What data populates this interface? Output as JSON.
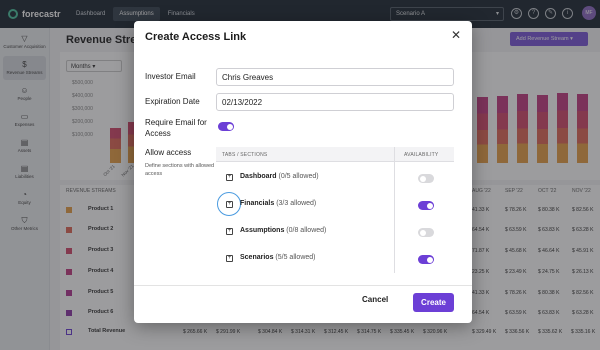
{
  "app": {
    "logo_text": "forecastr",
    "nav_tabs": [
      "Dashboard",
      "Assumptions",
      "Financials"
    ],
    "active_tab": "Assumptions",
    "scenario": "Scenario A",
    "avatar_initials": "MF"
  },
  "sidebar": {
    "items": [
      {
        "label": "Customer Acquisition",
        "icon": "funnel-icon",
        "glyph": "▽"
      },
      {
        "label": "Revenue Streams",
        "icon": "dollar-icon",
        "glyph": "$"
      },
      {
        "label": "People",
        "icon": "people-icon",
        "glyph": "☺"
      },
      {
        "label": "Expenses",
        "icon": "card-icon",
        "glyph": "▭"
      },
      {
        "label": "Assets",
        "icon": "document-icon",
        "glyph": "▤"
      },
      {
        "label": "Liabilities",
        "icon": "document-icon",
        "glyph": "▤"
      },
      {
        "label": "Equity",
        "icon": "pie-icon",
        "glyph": "◔"
      },
      {
        "label": "Other Metrics",
        "icon": "shield-icon",
        "glyph": "⛉"
      }
    ]
  },
  "main": {
    "title": "Revenue Strea",
    "add_button": "Add Revenue Stream",
    "period_select": "Months",
    "y_ticks": [
      "$500,000",
      "$400,000",
      "$300,000",
      "$200,000",
      "$100,000"
    ],
    "x_labels_left": [
      "Oct '21",
      "Nov '21",
      "Dec '21"
    ],
    "table_header": "REVENUE STREAMS",
    "months_right": [
      "AUG '22",
      "SEP '22",
      "OCT '22",
      "NOV '22"
    ],
    "rows": [
      {
        "name": "Product 1",
        "color": "#e8a04a",
        "vals": [
          "41.33 K",
          "$ 78.26 K",
          "$ 80.38 K",
          "$ 82.56 K"
        ]
      },
      {
        "name": "Product 2",
        "color": "#e06a5a",
        "vals": [
          "64.54 K",
          "$ 63.59 K",
          "$ 63.83 K",
          "$ 63.28 K"
        ]
      },
      {
        "name": "Product 3",
        "color": "#d44c6e",
        "vals": [
          "71.87 K",
          "$ 45.68 K",
          "$ 46.64 K",
          "$ 45.91 K"
        ]
      },
      {
        "name": "Product 4",
        "color": "#c43f84",
        "vals": [
          "23.25 K",
          "$ 23.49 K",
          "$ 24.75 K",
          "$ 26.13 K"
        ]
      },
      {
        "name": "Product 5",
        "color": "#b23a94",
        "vals": [
          "41.33 K",
          "$ 78.26 K",
          "$ 80.38 K",
          "$ 82.56 K"
        ]
      },
      {
        "name": "Product 6",
        "color": "#8e3aa8",
        "vals": [
          "64.54 K",
          "$ 63.59 K",
          "$ 63.83 K",
          "$ 63.28 K"
        ]
      }
    ],
    "total_label": "Total Revenue",
    "total_vals": [
      "$ 265.66 K",
      "$ 291.99 K",
      "$ 304.84 K",
      "$ 314.31 K",
      "$ 312.45 K",
      "$ 314.75 K",
      "$ 335.45 K",
      "$ 320.96 K",
      "$ 329.49 K",
      "$ 336.56 K",
      "$ 335.62 K",
      "$ 335.16 K"
    ]
  },
  "modal": {
    "title": "Create Access Link",
    "close_glyph": "✕",
    "investor_email_label": "Investor Email",
    "investor_email_value": "Chris Greaves",
    "expiration_label": "Expiration Date",
    "expiration_value": "02/13/2022",
    "require_email_label": "Require Email for Access",
    "require_email_on": true,
    "allow_access_title": "Allow access",
    "allow_access_desc": "Define sections with allowed access",
    "col_sections": "TABS / SECTIONS",
    "col_availability": "AVAILABILITY",
    "sections": [
      {
        "name": "Dashboard",
        "count": "(0/5 allowed)",
        "enabled": false
      },
      {
        "name": "Financials",
        "count": "(3/3 allowed)",
        "enabled": true
      },
      {
        "name": "Assumptions",
        "count": "(0/8 allowed)",
        "enabled": false
      },
      {
        "name": "Scenarios",
        "count": "(5/5 allowed)",
        "enabled": true
      }
    ],
    "expand_glyph": "+",
    "cancel_label": "Cancel",
    "create_label": "Create",
    "accent_color": "#6c3fd6"
  }
}
